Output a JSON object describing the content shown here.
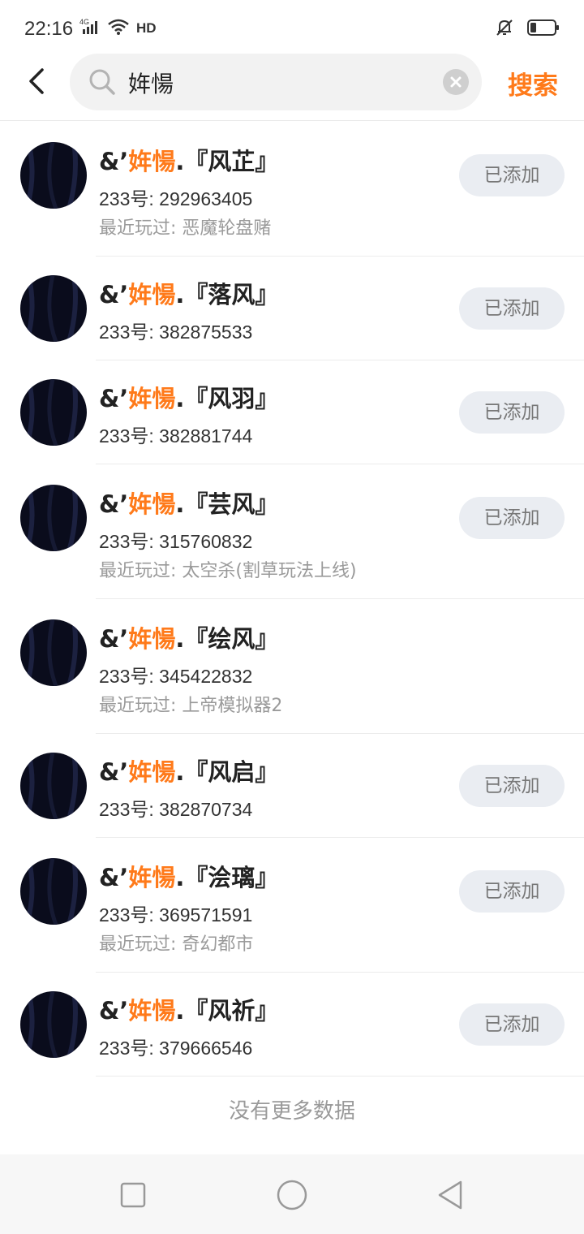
{
  "status_bar": {
    "time": "22:16",
    "network": "4G",
    "hd_label": "HD",
    "icons": [
      "signal-icon",
      "wifi-icon",
      "hd-icon",
      "bell-off-icon",
      "battery-icon"
    ]
  },
  "search": {
    "query": "姩愓",
    "button_label": "搜索",
    "accent_color": "#ff7a1a"
  },
  "labels": {
    "added": "已添加",
    "no_more": "没有更多数据"
  },
  "results": [
    {
      "prefix": "&’",
      "highlight": "姩愓",
      "suffix": ".『风芷』",
      "id": "233号: 292963405",
      "recent": "最近玩过: 恶魔轮盘赌",
      "button": "已添加"
    },
    {
      "prefix": "&’",
      "highlight": "姩愓",
      "suffix": ".『落风』",
      "id": "233号: 382875533",
      "recent": "",
      "button": "已添加"
    },
    {
      "prefix": "&’",
      "highlight": "姩愓",
      "suffix": ".『风羽』",
      "id": "233号: 382881744",
      "recent": "",
      "button": "已添加"
    },
    {
      "prefix": "&’",
      "highlight": "姩愓",
      "suffix": ".『芸风』",
      "id": "233号: 315760832",
      "recent": "最近玩过: 太空杀(割草玩法上线)",
      "button": "已添加"
    },
    {
      "prefix": "&’",
      "highlight": "姩愓",
      "suffix": ".『绘风』",
      "id": "233号: 345422832",
      "recent": "最近玩过: 上帝模拟器2",
      "button": ""
    },
    {
      "prefix": "&’",
      "highlight": "姩愓",
      "suffix": ".『风启』",
      "id": "233号: 382870734",
      "recent": "",
      "button": "已添加"
    },
    {
      "prefix": "&’",
      "highlight": "姩愓",
      "suffix": ".『浍璃』",
      "id": "233号: 369571591",
      "recent": "最近玩过: 奇幻都市",
      "button": "已添加"
    },
    {
      "prefix": "&’",
      "highlight": "姩愓",
      "suffix": ".『风祈』",
      "id": "233号: 379666546",
      "recent": "",
      "button": "已添加"
    }
  ]
}
